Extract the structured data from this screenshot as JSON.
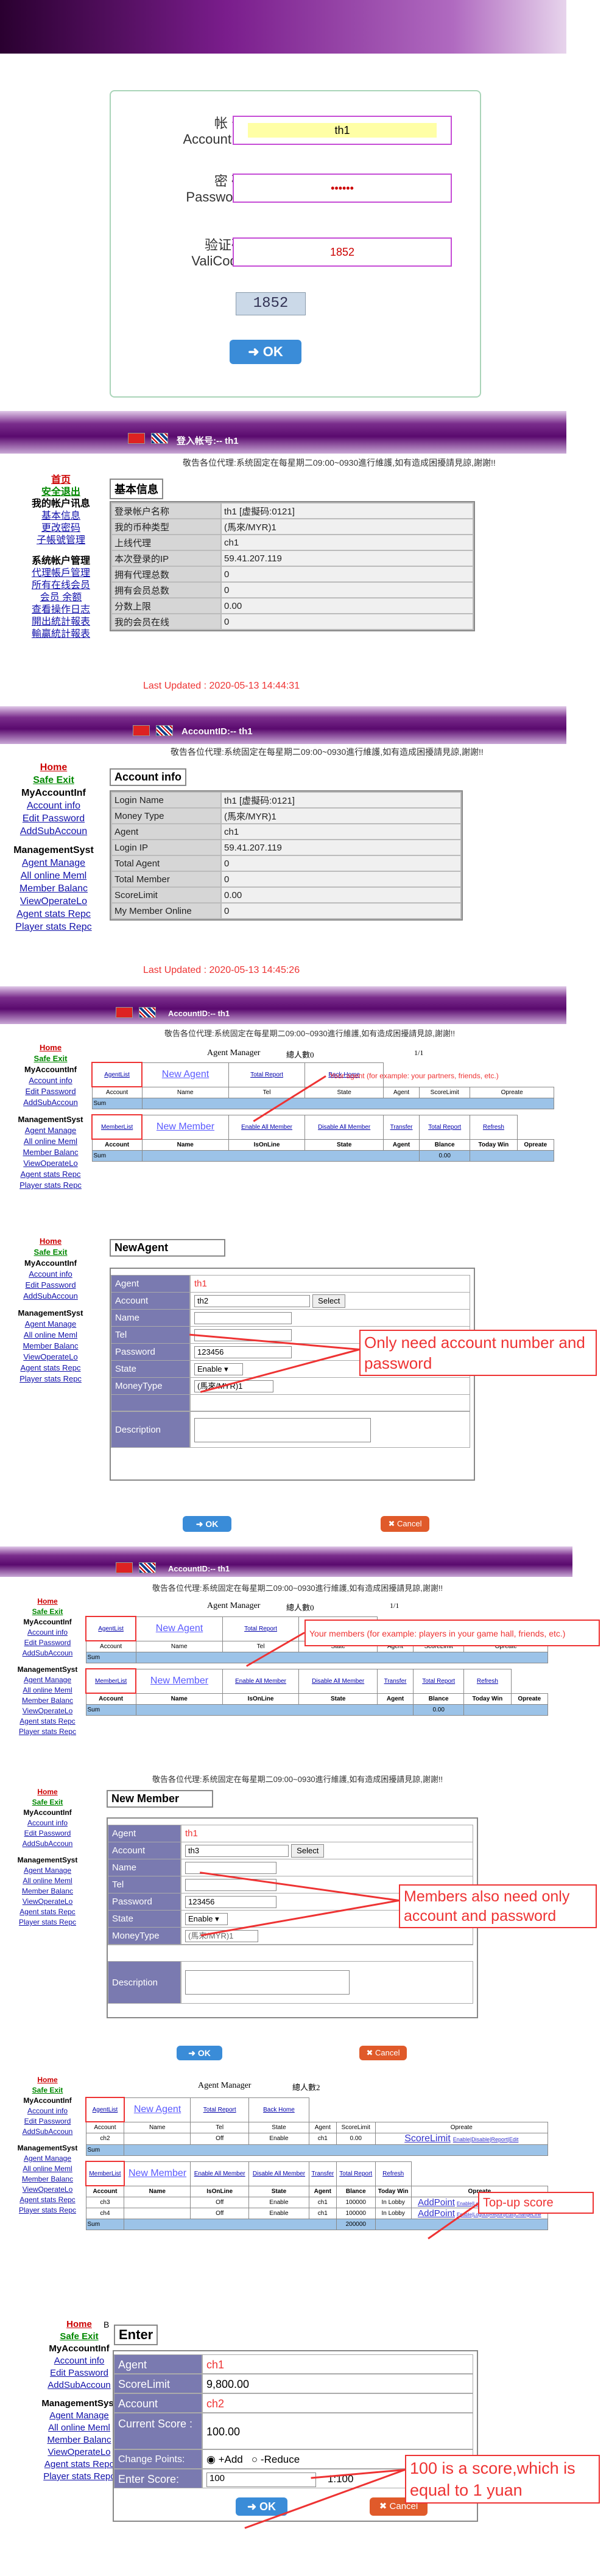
{
  "login": {
    "account_label": "帐 号",
    "account_label_en": "AccountID",
    "account_value": "th1",
    "password_label": "密 码",
    "password_label_en": "Password",
    "password_value": "••••••",
    "code_label": "验证码",
    "code_label_en": "ValiCode",
    "code_value": "1852",
    "captcha": "1852",
    "ok": "OK"
  },
  "notice": "敬告各位代理:系统固定在每星期二09:00~0930進行維護,如有造成困擾請見諒,謝謝!!",
  "notice2": "敬告各位代理:系统固定在每星期二09:00~0930進行維護,如有造成困擾請見諒,謝謝!!",
  "s1": {
    "title": "登入帐号:-- th1",
    "box": "基本信息",
    "rows": [
      [
        "登录帐户名称",
        "th1 [虚擬码:0121]"
      ],
      [
        "我的币种类型",
        "(馬來/MYR)1"
      ],
      [
        "上线代理",
        "ch1"
      ],
      [
        "本次登录的IP",
        "59.41.207.119"
      ],
      [
        "拥有代理总数",
        "0"
      ],
      [
        "拥有会员总数",
        "0"
      ],
      [
        "分数上限",
        "0.00"
      ],
      [
        "我的会员在线",
        "0"
      ]
    ],
    "updated": "Last Updated : 2020-05-13 14:44:31",
    "side": {
      "home": "首页",
      "exit": "安全退出",
      "head1": "我的帐户讯息",
      "l1": "基本信息",
      "l2": "更改密码",
      "l3": "子帳號管理",
      "head2": "系统帐户管理",
      "l4": "代理帳戶管理",
      "l5": "所有在线会员",
      "l6": "会员 余额",
      "l7": "查看操作日志",
      "l8": "開出統計報表",
      "l9": "輸贏統計報表"
    }
  },
  "s2": {
    "title": "AccountID:-- th1",
    "box": "Account info",
    "rows": [
      [
        "Login Name",
        "th1 [虚擬码:0121]"
      ],
      [
        "Money Type",
        "(馬來/MYR)1"
      ],
      [
        "Agent",
        "ch1"
      ],
      [
        "Login IP",
        "59.41.207.119"
      ],
      [
        "Total Agent",
        "0"
      ],
      [
        "Total Member",
        "0"
      ],
      [
        "ScoreLimit",
        "0.00"
      ],
      [
        "My Member Online",
        "0"
      ]
    ],
    "updated": "Last Updated : 2020-05-13 14:45:26"
  },
  "side_en": {
    "home": "Home",
    "exit": "Safe Exit",
    "head1": "MyAccountInf",
    "l1": "Account info",
    "l2": "Edit Password",
    "l3": "AddSubAccoun",
    "head2": "ManagementSyst",
    "l4": "Agent Manage",
    "l5": "All online Meml",
    "l6": "Member Balanc",
    "l7": "ViewOperateLo",
    "l8": "Agent stats Repc",
    "l9": "Player stats Repc"
  },
  "s3": {
    "title": "AccountID:-- th1",
    "mgr": "Agent Manager",
    "count": "總人數0",
    "page": "1/1",
    "annot": "Your agent (for example: your partners, friends, etc.)",
    "agentlist": "AgentList",
    "newagent": "New Agent",
    "totalreport": "Total Report",
    "backhome": "Back Home",
    "cols": [
      "Account",
      "Name",
      "Tel",
      "State",
      "Agent",
      "ScoreLimit",
      "Opreate"
    ],
    "sum": "Sum",
    "memberlist": "MemberList",
    "newmember": "New Member",
    "enableall": "Enable All Member",
    "disableall": "Disable All Member",
    "transfer": "Transfer",
    "refresh": "Refresh",
    "mcols": [
      "Account",
      "Name",
      "IsOnLine",
      "State",
      "Agent",
      "Blance",
      "Today Win",
      "Opreate"
    ],
    "zero": "0.00"
  },
  "s4": {
    "box": "NewAgent",
    "agent_k": "Agent",
    "agent_v": "th1",
    "account_k": "Account",
    "account_v": "th2",
    "select": "Select",
    "name_k": "Name",
    "tel_k": "Tel",
    "pw_k": "Password",
    "pw_v": "123456",
    "state_k": "State",
    "state_v": "Enable",
    "mt_k": "MoneyType",
    "mt_v": "(馬來/MYR)1",
    "desc_k": "Description",
    "annot": "Only need account number and password",
    "ok": "OK",
    "cancel": "Cancel"
  },
  "s5": {
    "annot": "Your members (for example: players in your game hall, friends, etc.)"
  },
  "s6": {
    "box": "New Member",
    "agent_v": "th1",
    "account_v": "th3",
    "pw_v": "123456",
    "mt_v": "(馬來/MYR)1",
    "annot": "Members also need only account and password",
    "ok": "OK",
    "cancel": "Cancel"
  },
  "s7": {
    "mgr": "Agent Manager",
    "count": "總人數2",
    "annot": "Top-up score",
    "scorelimit": "ScoreLimit",
    "ops": "Enable|Disable|Report|Edit",
    "addpoint": "AddPoint",
    "mops": "Enable|Logout|Report|Edit|ChangeLine",
    "r1": [
      "ch2",
      "",
      "Off",
      "Enable",
      "ch1",
      "0.00",
      "0"
    ],
    "r2": [
      "ch3",
      "",
      "Off",
      "Enable",
      "ch1",
      "100000",
      "In Lobby"
    ],
    "r3": [
      "ch4",
      "",
      "Off",
      "Enable",
      "ch1",
      "100000",
      "In Lobby"
    ],
    "sum": "200000"
  },
  "s8": {
    "box": "Enter",
    "agent_k": "Agent",
    "agent_v": "ch1",
    "sl_k": "ScoreLimit",
    "sl_v": "9,800.00",
    "acc_k": "Account",
    "acc_v": "ch2",
    "cur_k": "Current Score :",
    "cur_v": "100.00",
    "cp_k": "Change Points:",
    "add": "+Add",
    "reduce": "-Reduce",
    "es_k": "Enter Score:",
    "es_v": "100",
    "ratio": "1:100",
    "annot": "100 is a score,which is equal to 1 yuan",
    "ok": "OK",
    "cancel": "Cancel",
    "b": "B"
  },
  "colors": {
    "purple": "#5a0a6e",
    "red": "#e33",
    "green": "#0a0"
  }
}
